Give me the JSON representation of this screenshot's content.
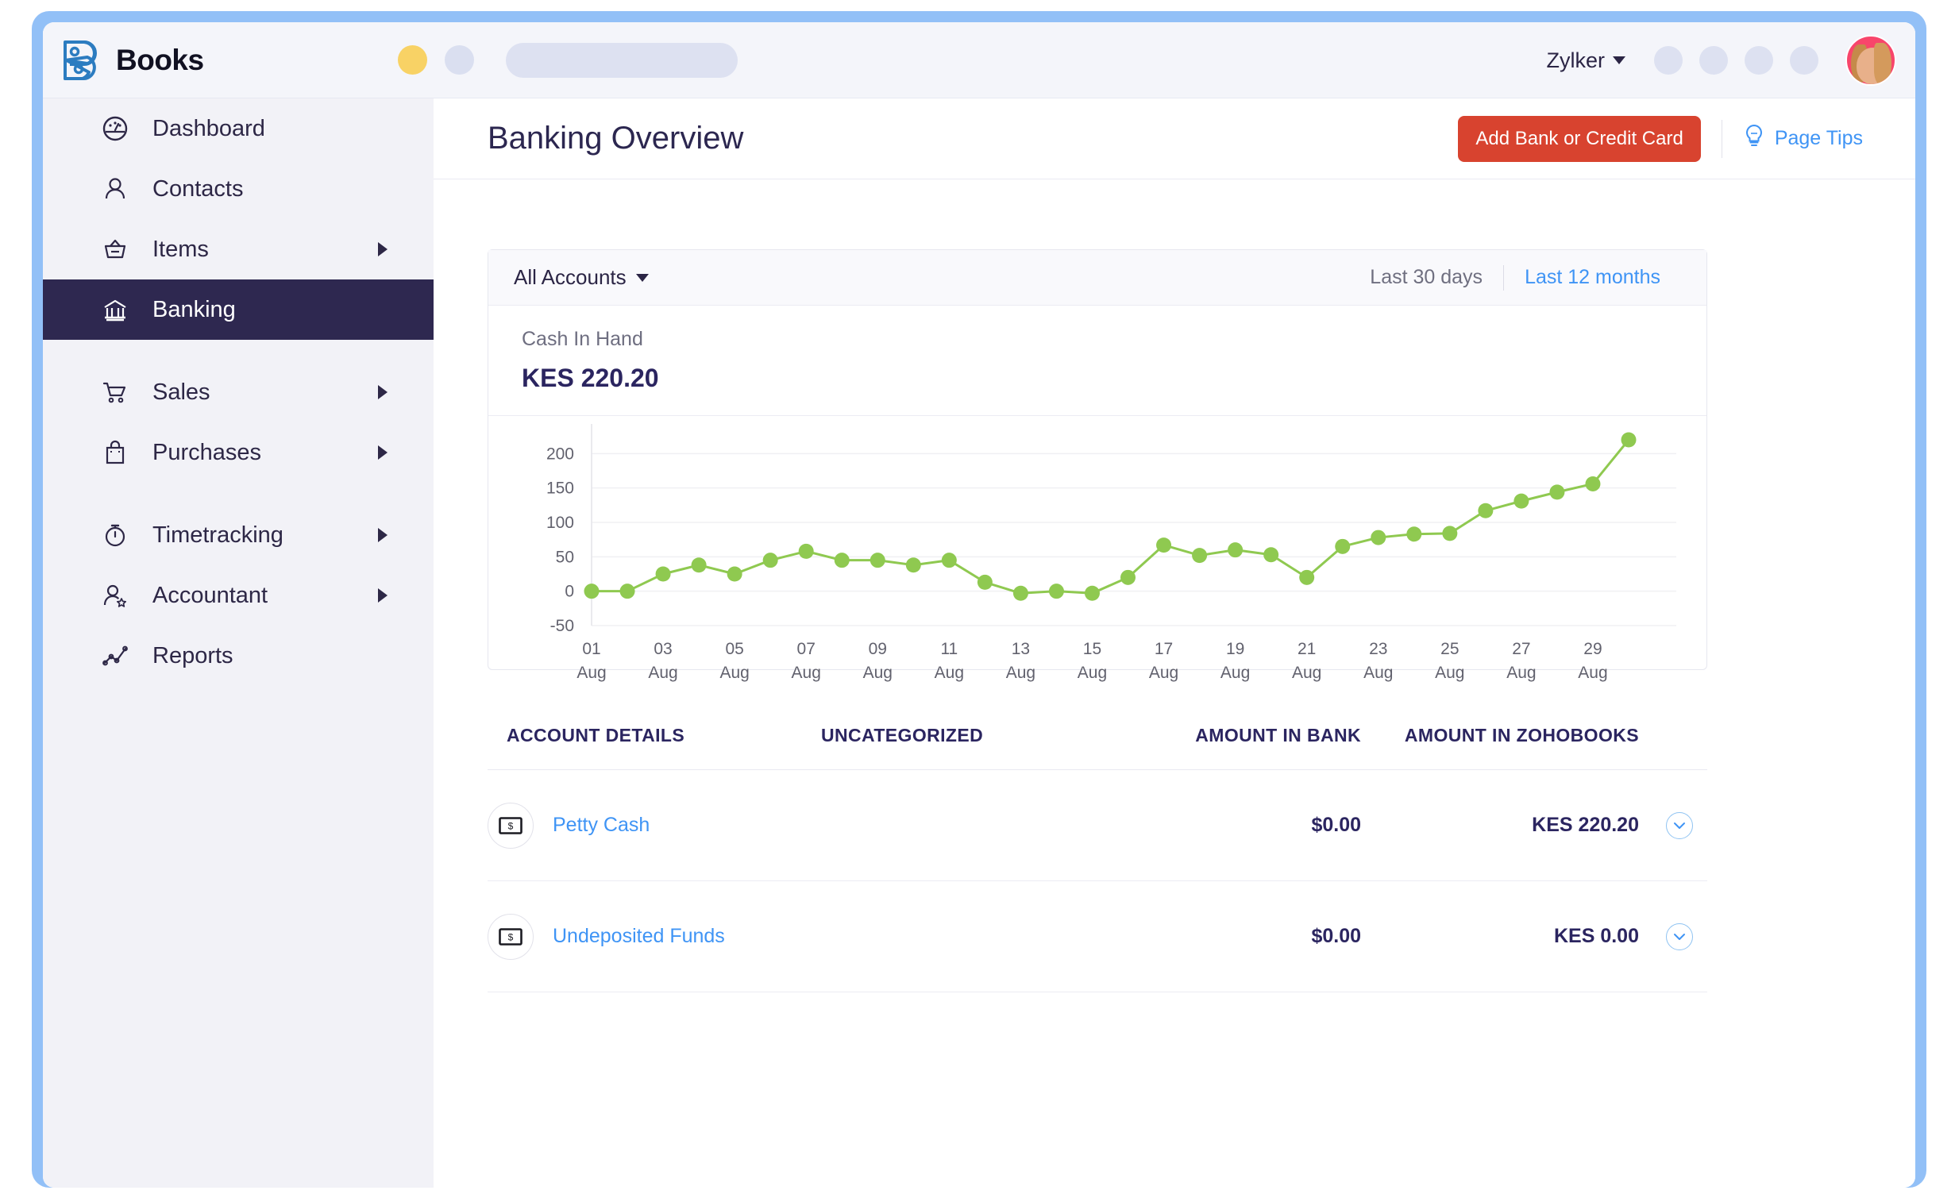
{
  "brand": {
    "name": "Books"
  },
  "topbar": {
    "org": "Zylker",
    "icon_count": 4
  },
  "sidebar": {
    "items": [
      {
        "label": "Dashboard",
        "icon": "dashboard-icon",
        "arrow": false,
        "active": false
      },
      {
        "label": "Contacts",
        "icon": "contacts-icon",
        "arrow": false,
        "active": false
      },
      {
        "label": "Items",
        "icon": "items-icon",
        "arrow": true,
        "active": false
      },
      {
        "label": "Banking",
        "icon": "bank-icon",
        "arrow": false,
        "active": true
      },
      {
        "label": "Sales",
        "icon": "cart-icon",
        "arrow": true,
        "active": false
      },
      {
        "label": "Purchases",
        "icon": "bag-icon",
        "arrow": true,
        "active": false
      },
      {
        "label": "Timetracking",
        "icon": "stopwatch-icon",
        "arrow": true,
        "active": false
      },
      {
        "label": "Accountant",
        "icon": "accountant-icon",
        "arrow": true,
        "active": false
      },
      {
        "label": "Reports",
        "icon": "reports-icon",
        "arrow": false,
        "active": false
      }
    ]
  },
  "page": {
    "title": "Banking Overview",
    "add_bank_label": "Add Bank or Credit Card",
    "page_tips_label": "Page Tips"
  },
  "card": {
    "account_filter": "All Accounts",
    "range_last30": "Last 30 days",
    "range_last12": "Last 12 months",
    "cash_label": "Cash In Hand",
    "cash_value": "KES 220.20"
  },
  "table": {
    "headers": [
      "ACCOUNT DETAILS",
      "UNCATEGORIZED",
      "AMOUNT IN BANK",
      "AMOUNT IN ZOHOBOOKS"
    ],
    "rows": [
      {
        "account": "Petty Cash",
        "uncategorized": "",
        "amount_in_bank": "$0.00",
        "amount_in_zohobooks": "KES 220.20"
      },
      {
        "account": "Undeposited Funds",
        "uncategorized": "",
        "amount_in_bank": "$0.00",
        "amount_in_zohobooks": "KES 0.00"
      }
    ]
  },
  "colors": {
    "accent_red": "#d8432f",
    "accent_blue": "#3f94f5",
    "sidebar_active": "#2e2850",
    "chart_green": "#8fc950",
    "brand_blue": "#2c7cc0"
  },
  "chart_data": {
    "type": "line",
    "title": "Cash In Hand",
    "xlabel": "",
    "ylabel": "",
    "ylim": [
      -50,
      220
    ],
    "yticks": [
      -50,
      0,
      50,
      100,
      150,
      200
    ],
    "grid": true,
    "legend": "none",
    "series_color": "#8fc950",
    "x_tick_labels": [
      "01\nAug",
      "03\nAug",
      "05\nAug",
      "07\nAug",
      "09\nAug",
      "11\nAug",
      "13\nAug",
      "15\nAug",
      "17\nAug",
      "19\nAug",
      "21\nAug",
      "23\nAug",
      "25\nAug",
      "27\nAug",
      "29\nAug"
    ],
    "x": [
      "01 Aug",
      "02 Aug",
      "03 Aug",
      "04 Aug",
      "05 Aug",
      "06 Aug",
      "07 Aug",
      "08 Aug",
      "09 Aug",
      "10 Aug",
      "11 Aug",
      "12 Aug",
      "13 Aug",
      "14 Aug",
      "15 Aug",
      "16 Aug",
      "17 Aug",
      "18 Aug",
      "19 Aug",
      "20 Aug",
      "21 Aug",
      "22 Aug",
      "23 Aug",
      "24 Aug",
      "25 Aug",
      "26 Aug",
      "27 Aug",
      "28 Aug",
      "29 Aug",
      "30 Aug"
    ],
    "values": [
      0,
      0,
      25,
      38,
      25,
      45,
      58,
      45,
      45,
      38,
      45,
      13,
      -3,
      0,
      -3,
      20,
      67,
      52,
      60,
      53,
      20,
      65,
      78,
      83,
      84,
      117,
      131,
      144,
      156,
      220
    ]
  }
}
